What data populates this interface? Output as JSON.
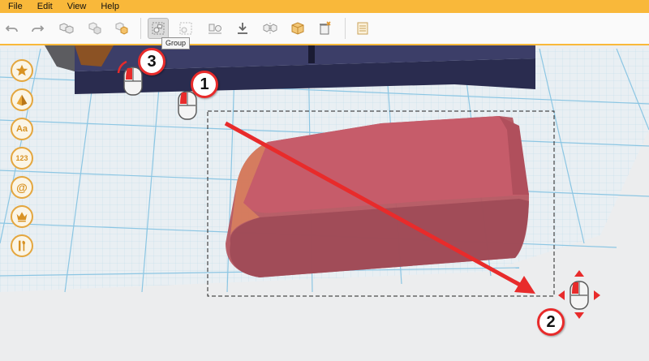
{
  "menu": {
    "items": [
      "File",
      "Edit",
      "View",
      "Help"
    ]
  },
  "toolbar": {
    "buttons": [
      {
        "name": "undo-button",
        "icon": "undo-icon"
      },
      {
        "name": "redo-button",
        "icon": "redo-icon"
      },
      {
        "name": "copy-button",
        "icon": "copy-icon"
      },
      {
        "name": "paste-button",
        "icon": "paste-icon"
      },
      {
        "name": "duplicate-button",
        "icon": "duplicate-icon"
      },
      {
        "name": "group-button",
        "icon": "group-icon",
        "active": true
      },
      {
        "name": "ungroup-button",
        "icon": "ungroup-icon"
      },
      {
        "name": "align-button",
        "icon": "align-icon"
      },
      {
        "name": "drop-to-plane-button",
        "icon": "drop-icon"
      },
      {
        "name": "mirror-button",
        "icon": "mirror-icon"
      },
      {
        "name": "solid-button",
        "icon": "solid-box-icon"
      },
      {
        "name": "delete-button",
        "icon": "delete-icon"
      },
      {
        "name": "notes-button",
        "icon": "notes-icon"
      }
    ],
    "tooltip": "Group"
  },
  "side_tools": [
    {
      "name": "favorites-tool",
      "icon": "star-icon",
      "label": ""
    },
    {
      "name": "shapes-tool",
      "icon": "pyramid-icon",
      "label": ""
    },
    {
      "name": "text-tool",
      "icon": "text-icon",
      "label": "Aa"
    },
    {
      "name": "number-tool",
      "icon": "number-icon",
      "label": "123"
    },
    {
      "name": "symbol-tool",
      "icon": "at-icon",
      "label": "@"
    },
    {
      "name": "crown-tool",
      "icon": "crown-icon",
      "label": ""
    },
    {
      "name": "tools-tool",
      "icon": "tools-icon",
      "label": ""
    }
  ],
  "steps": {
    "step1": "1",
    "step2": "2",
    "step3": "3"
  },
  "colors": {
    "accent": "#f9b83a",
    "shape_fill": "#c65a68",
    "dark_object": "#33355a",
    "annotation_red": "#e82b2b"
  }
}
